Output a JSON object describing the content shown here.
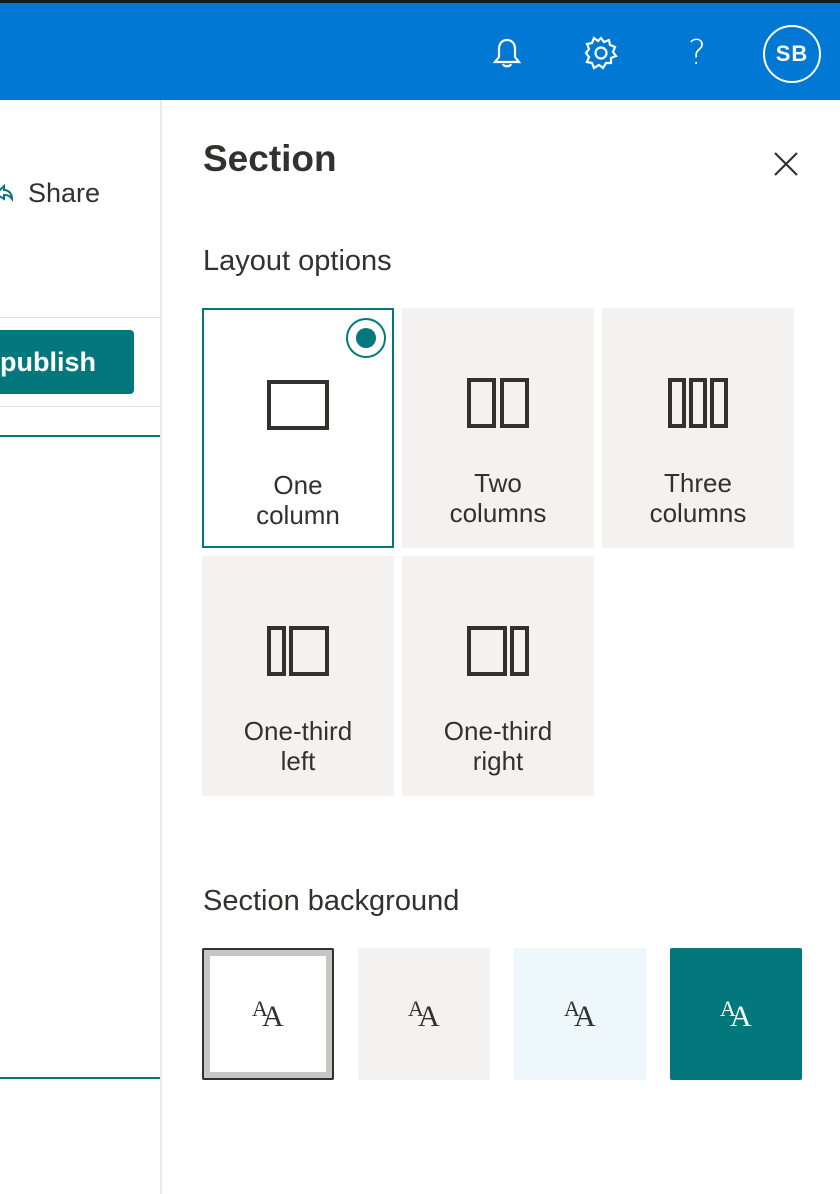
{
  "header": {
    "notifications_icon": "bell-icon",
    "settings_icon": "gear-icon",
    "help_label": "?",
    "avatar_initials": "SB",
    "brand_color": "#0078d4"
  },
  "page": {
    "share_label": "Share",
    "publish_label": "publish",
    "accent_color": "#03787c"
  },
  "panel": {
    "title": "Section",
    "close_icon": "close-icon",
    "layout_heading": "Layout options",
    "layouts": [
      {
        "label": "One\ncolumn",
        "icon": "one-column-icon",
        "selected": true
      },
      {
        "label": "Two\ncolumns",
        "icon": "two-columns-icon",
        "selected": false
      },
      {
        "label": "Three\ncolumns",
        "icon": "three-columns-icon",
        "selected": false
      },
      {
        "label": "One-third\nleft",
        "icon": "one-third-left-icon",
        "selected": false
      },
      {
        "label": "One-third\nright",
        "icon": "one-third-right-icon",
        "selected": false
      }
    ],
    "background_heading": "Section background",
    "backgrounds": [
      {
        "name": "none",
        "color": "#ffffff",
        "text_color": "#323130",
        "selected": true,
        "glyph_small": "A",
        "glyph_big": "A"
      },
      {
        "name": "neutral",
        "color": "#f3f2f1",
        "text_color": "#323130",
        "selected": false,
        "glyph_small": "A",
        "glyph_big": "A"
      },
      {
        "name": "soft",
        "color": "#eef7f9",
        "text_color": "#323130",
        "selected": false,
        "glyph_small": "A",
        "glyph_big": "A"
      },
      {
        "name": "strong",
        "color": "#03787c",
        "text_color": "#ffffff",
        "selected": false,
        "glyph_small": "A",
        "glyph_big": "A"
      }
    ]
  }
}
